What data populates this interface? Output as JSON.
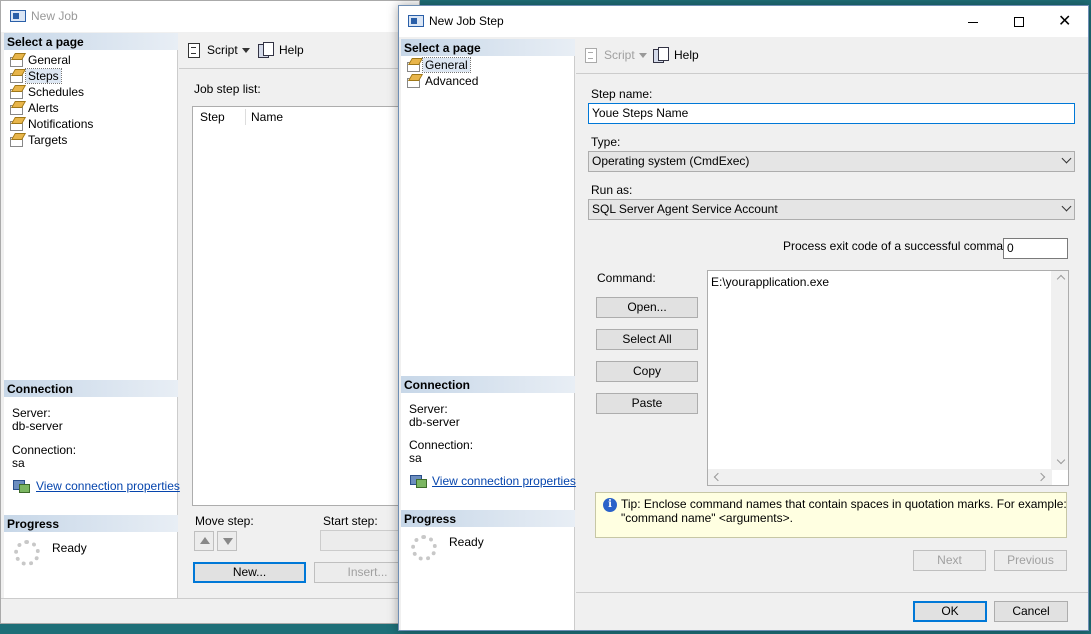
{
  "new_job": {
    "title": "New Job",
    "select_page": "Select a page",
    "nav": [
      "General",
      "Steps",
      "Schedules",
      "Alerts",
      "Notifications",
      "Targets"
    ],
    "toolbar": {
      "script": "Script",
      "help": "Help"
    },
    "job_step_list_label": "Job step list:",
    "columns": [
      "Step",
      "Name"
    ],
    "connection": {
      "header": "Connection",
      "server_label": "Server:",
      "server": "db-server",
      "connection_label": "Connection:",
      "connection": "sa",
      "view_props": "View connection properties"
    },
    "progress": {
      "header": "Progress",
      "status": "Ready"
    },
    "move_step": "Move step:",
    "start_step": "Start step:",
    "new_button": "New...",
    "insert_button": "Insert..."
  },
  "step_dialog": {
    "title": "New Job Step",
    "select_page": "Select a page",
    "nav": [
      "General",
      "Advanced"
    ],
    "toolbar": {
      "script": "Script",
      "help": "Help"
    },
    "step_name_label": "Step name:",
    "step_name_value": "Youe Steps Name",
    "type_label": "Type:",
    "type_value": "Operating system (CmdExec)",
    "run_as_label": "Run as:",
    "run_as_value": "SQL Server Agent Service Account",
    "exit_code_label": "Process exit code of a successful command:",
    "exit_code_value": "0",
    "command_label": "Command:",
    "command_value": "E:\\yourapplication.exe",
    "buttons": {
      "open": "Open...",
      "select_all": "Select All",
      "copy": "Copy",
      "paste": "Paste"
    },
    "tip_line1": "Tip: Enclose command names that contain spaces in quotation marks. For example:",
    "tip_line2": "\"command name\" <arguments>.",
    "next": "Next",
    "previous": "Previous",
    "ok": "OK",
    "cancel": "Cancel",
    "connection": {
      "header": "Connection",
      "server_label": "Server:",
      "server": "db-server",
      "connection_label": "Connection:",
      "connection": "sa",
      "view_props": "View connection properties"
    },
    "progress": {
      "header": "Progress",
      "status": "Ready"
    }
  }
}
